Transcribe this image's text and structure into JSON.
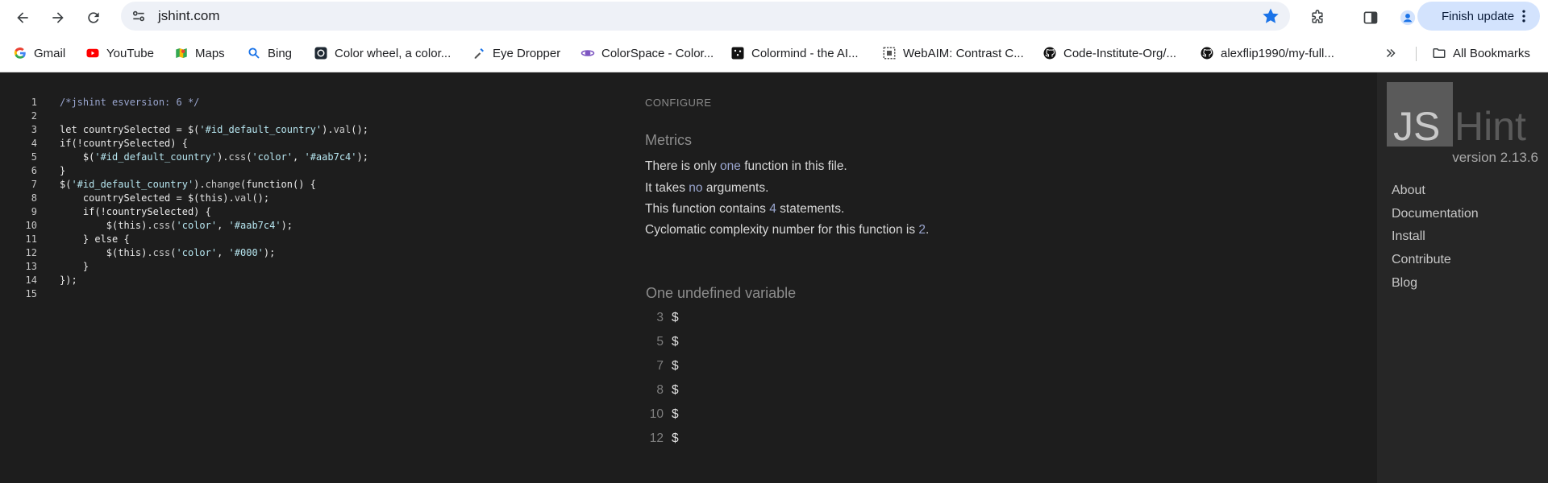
{
  "browser": {
    "url": "jshint.com",
    "finish_update_label": "Finish update",
    "bookmarks": [
      {
        "label": "Gmail",
        "icon": "gmail-icon"
      },
      {
        "label": "YouTube",
        "icon": "youtube-icon"
      },
      {
        "label": "Maps",
        "icon": "maps-icon"
      },
      {
        "label": "Bing",
        "icon": "bing-icon"
      },
      {
        "label": "Color wheel, a color...",
        "icon": "color-wheel-icon"
      },
      {
        "label": "Eye Dropper",
        "icon": "eye-dropper-icon"
      },
      {
        "label": "ColorSpace - Color...",
        "icon": "colorspace-icon"
      },
      {
        "label": "Colormind - the AI...",
        "icon": "colormind-icon"
      },
      {
        "label": "WebAIM: Contrast C...",
        "icon": "webaim-icon"
      },
      {
        "label": "Code-Institute-Org/...",
        "icon": "github-icon"
      },
      {
        "label": "alexflip1990/my-full...",
        "icon": "github-icon"
      }
    ],
    "all_bookmarks_label": "All Bookmarks"
  },
  "editor": {
    "lines": [
      {
        "n": "1"
      },
      {
        "n": "2"
      },
      {
        "n": "3"
      },
      {
        "n": "4"
      },
      {
        "n": "5"
      },
      {
        "n": "6"
      },
      {
        "n": "7"
      },
      {
        "n": "8"
      },
      {
        "n": "9"
      },
      {
        "n": "10"
      },
      {
        "n": "11"
      },
      {
        "n": "12"
      },
      {
        "n": "13"
      },
      {
        "n": "14"
      },
      {
        "n": "15"
      }
    ],
    "code": {
      "l1": "/*jshint esversion: 6 */",
      "l3a": "let countrySelected = $(",
      "l3b": "'#id_default_country'",
      "l3c": ").",
      "l3d": "val",
      "l3e": "();",
      "l4": "if(!countrySelected) {",
      "l5a": "    $(",
      "l5b": "'#id_default_country'",
      "l5c": ").",
      "l5d": "css",
      "l5e": "(",
      "l5f": "'color'",
      "l5g": ", ",
      "l5h": "'#aab7c4'",
      "l5i": ");",
      "l6": "}",
      "l7a": "$(",
      "l7b": "'#id_default_country'",
      "l7c": ").",
      "l7d": "change",
      "l7e": "(function() {",
      "l8a": "    countrySelected = $(this).",
      "l8b": "val",
      "l8c": "();",
      "l9": "    if(!countrySelected) {",
      "l10a": "        $(this).",
      "l10b": "css",
      "l10c": "(",
      "l10d": "'color'",
      "l10e": ", ",
      "l10f": "'#aab7c4'",
      "l10g": ");",
      "l11": "    } else {",
      "l12a": "        $(this).",
      "l12b": "css",
      "l12c": "(",
      "l12d": "'color'",
      "l12e": ", ",
      "l12f": "'#000'",
      "l12g": ");",
      "l13": "    }",
      "l14": "});"
    }
  },
  "report": {
    "configure_label": "CONFIGURE",
    "metrics_title": "Metrics",
    "metric1_pre": "There is only ",
    "metric1_hl": "one",
    "metric1_post": " function in this file.",
    "metric2_pre": "It takes ",
    "metric2_hl": "no",
    "metric2_post": " arguments.",
    "metric3_pre": "This function contains ",
    "metric3_hl": "4",
    "metric3_post": " statements.",
    "metric4_pre": "Cyclomatic complexity number for this function is ",
    "metric4_hl": "2",
    "metric4_post": ".",
    "undefined_title": "One undefined variable",
    "undefined": [
      {
        "line": "3",
        "var": "$"
      },
      {
        "line": "5",
        "var": "$"
      },
      {
        "line": "7",
        "var": "$"
      },
      {
        "line": "8",
        "var": "$"
      },
      {
        "line": "10",
        "var": "$"
      },
      {
        "line": "12",
        "var": "$"
      }
    ]
  },
  "sidebar": {
    "logo_left": "JS",
    "logo_right": "Hint",
    "version": "version 2.13.6",
    "links": [
      "About",
      "Documentation",
      "Install",
      "Contribute",
      "Blog"
    ]
  },
  "colors": {
    "page_bg": "#1d1d1d",
    "sidebar_bg": "#262626",
    "accent_blue": "#1a73e8",
    "update_pill": "#d3e3fd"
  }
}
